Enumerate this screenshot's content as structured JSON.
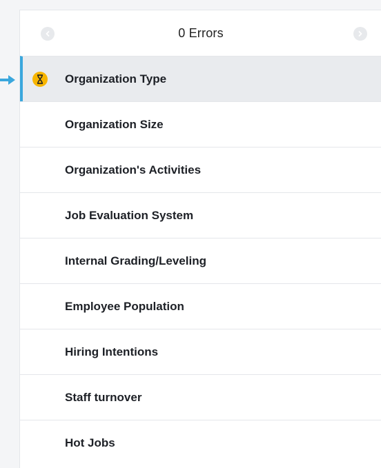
{
  "header": {
    "title": "0 Errors",
    "prev_icon": "chevron-left-icon",
    "next_icon": "chevron-right-icon"
  },
  "steps": [
    {
      "label": "Organization Type",
      "active": true,
      "status_icon": "hourglass-icon",
      "status_color": "#f7b500"
    },
    {
      "label": "Organization Size",
      "active": false
    },
    {
      "label": "Organization's Activities",
      "active": false
    },
    {
      "label": "Job Evaluation System",
      "active": false
    },
    {
      "label": "Internal Grading/Leveling",
      "active": false
    },
    {
      "label": "Employee Population",
      "active": false
    },
    {
      "label": "Hiring Intentions",
      "active": false
    },
    {
      "label": "Staff turnover",
      "active": false
    },
    {
      "label": "Hot Jobs",
      "active": false
    }
  ],
  "colors": {
    "accent": "#3aa7dd",
    "active_bg": "#e9ebee",
    "pending": "#f7b500"
  },
  "pointer_icon": "arrow-right-icon"
}
